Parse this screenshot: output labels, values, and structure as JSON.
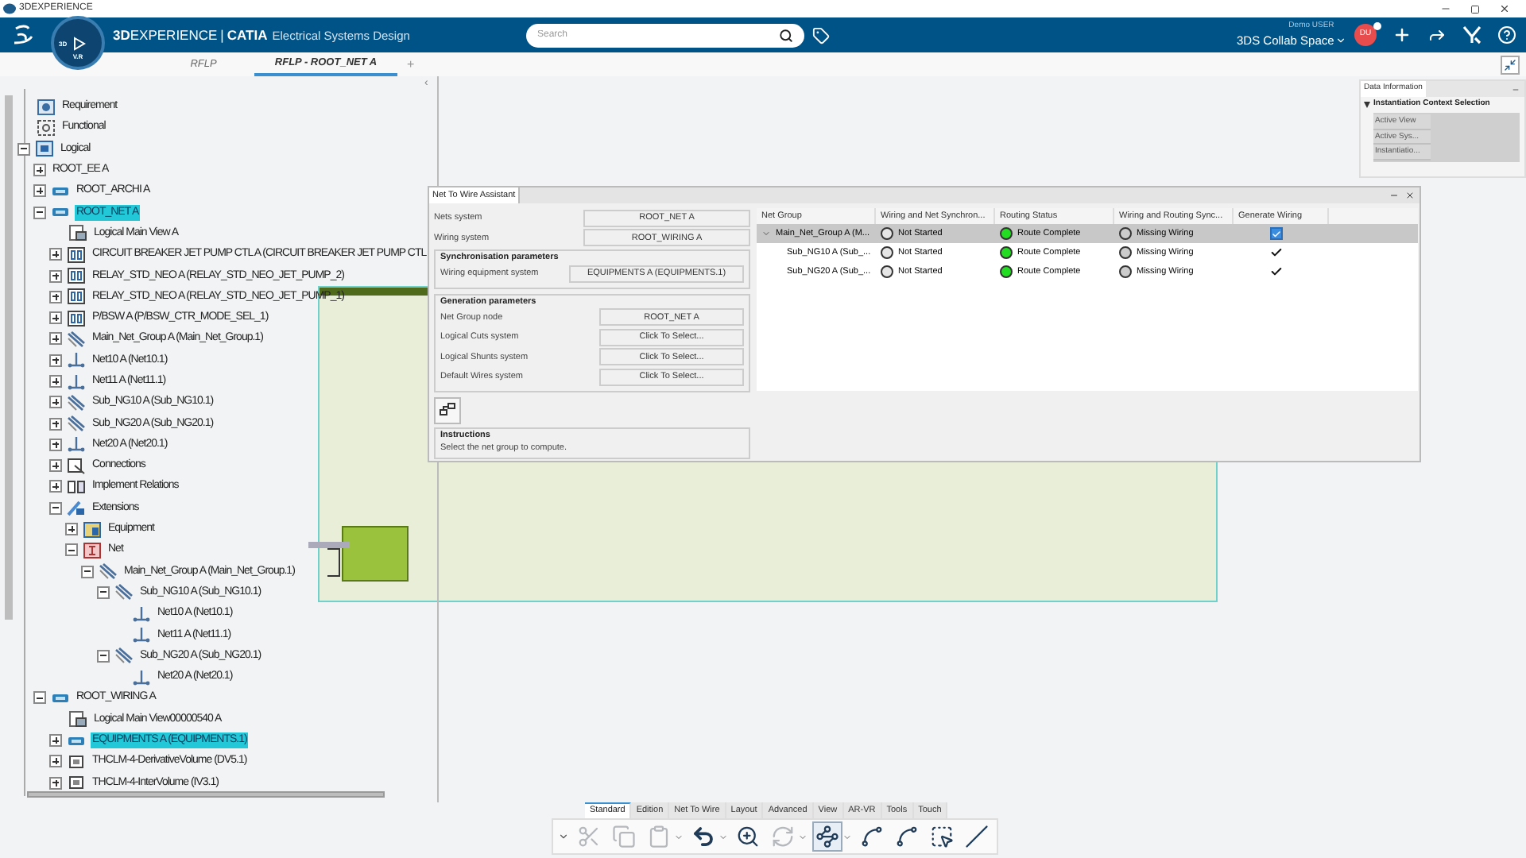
{
  "window": {
    "title": "3DEXPERIENCE"
  },
  "header": {
    "brand_bold": "3D",
    "brand_rest": "EXPERIENCE",
    "separator": "|",
    "product": "CATIA",
    "app": "Electrical Systems Design",
    "compass_left": "3D",
    "compass_bottom": "V.R",
    "search": {
      "placeholder": "Search"
    },
    "user": "Demo USER",
    "space": "3DS Collab Space",
    "avatar": "DU",
    "notification": true
  },
  "tabs": [
    {
      "label": "RFLP",
      "selected": false
    },
    {
      "label": "RFLP - ROOT_NET A",
      "selected": true
    }
  ],
  "add_tab": "+",
  "panel_collapse": "‹",
  "tree": [
    {
      "label": "Requirement",
      "kind": "requirement",
      "selected": false
    },
    {
      "label": "Functional",
      "kind": "functional",
      "selected": false
    },
    {
      "label": "Logical",
      "kind": "logical",
      "selected": false,
      "expanded": true,
      "children": [
        {
          "label": "ROOT_EE A",
          "kind": "none",
          "selected": false,
          "expanded": false
        },
        {
          "label": "ROOT_ARCHI A",
          "kind": "product",
          "selected": false,
          "expanded": false
        },
        {
          "label": "ROOT_NET A",
          "kind": "product",
          "selected": true,
          "expanded": true,
          "children": [
            {
              "label": "Logical Main View A",
              "kind": "view",
              "selected": false
            },
            {
              "label": "CIRCUIT BREAKER JET PUMP CTL A (CIRCUIT BREAKER JET PUMP CTL",
              "kind": "equipment",
              "selected": false,
              "expanded": false
            },
            {
              "label": "RELAY_STD_NEO A (RELAY_STD_NEO_JET_PUMP_2)",
              "kind": "equipment",
              "selected": false,
              "expanded": false
            },
            {
              "label": "RELAY_STD_NEO A (RELAY_STD_NEO_JET_PUMP_1)",
              "kind": "equipment",
              "selected": false,
              "expanded": false
            },
            {
              "label": "P/BSW A (P/BSW_CTR_MODE_SEL_1)",
              "kind": "equipment",
              "selected": false,
              "expanded": false
            },
            {
              "label": "Main_Net_Group A (Main_Net_Group.1)",
              "kind": "netgroup",
              "selected": false,
              "expanded": false
            },
            {
              "label": "Net10 A (Net10.1)",
              "kind": "net",
              "selected": false,
              "expanded": false
            },
            {
              "label": "Net11 A (Net11.1)",
              "kind": "net",
              "selected": false,
              "expanded": false
            },
            {
              "label": "Sub_NG10 A (Sub_NG10.1)",
              "kind": "netgroup",
              "selected": false,
              "expanded": false
            },
            {
              "label": "Sub_NG20 A (Sub_NG20.1)",
              "kind": "netgroup",
              "selected": false,
              "expanded": false
            },
            {
              "label": "Net20 A (Net20.1)",
              "kind": "net",
              "selected": false,
              "expanded": false
            },
            {
              "label": "Connections",
              "kind": "connections",
              "selected": false,
              "expanded": false
            },
            {
              "label": "Implement Relations",
              "kind": "relations",
              "selected": false,
              "expanded": false
            },
            {
              "label": "Extensions",
              "kind": "extensions",
              "selected": false,
              "expanded": true,
              "children": [
                {
                  "label": "Equipment",
                  "kind": "equipment_ext",
                  "selected": false,
                  "expanded": false
                },
                {
                  "label": "Net",
                  "kind": "net_ext",
                  "selected": false,
                  "expanded": true,
                  "children": [
                    {
                      "label": "Main_Net_Group A (Main_Net_Group.1)",
                      "kind": "netgroup",
                      "selected": false,
                      "expanded": true,
                      "children": [
                        {
                          "label": "Sub_NG10 A (Sub_NG10.1)",
                          "kind": "netgroup",
                          "selected": false,
                          "expanded": true,
                          "children": [
                            {
                              "label": "Net10 A (Net10.1)",
                              "kind": "net",
                              "selected": false
                            },
                            {
                              "label": "Net11 A (Net11.1)",
                              "kind": "net",
                              "selected": false
                            }
                          ]
                        },
                        {
                          "label": "Sub_NG20 A (Sub_NG20.1)",
                          "kind": "netgroup",
                          "selected": false,
                          "expanded": true,
                          "children": [
                            {
                              "label": "Net20 A (Net20.1)",
                              "kind": "net",
                              "selected": false
                            }
                          ]
                        }
                      ]
                    }
                  ]
                }
              ]
            }
          ]
        },
        {
          "label": "ROOT_WIRING A",
          "kind": "product",
          "selected": false,
          "expanded": true,
          "children": [
            {
              "label": "Logical Main View00000540 A",
              "kind": "view",
              "selected": false
            },
            {
              "label": "EQUIPMENTS A (EQUIPMENTS.1)",
              "kind": "product",
              "selected": true,
              "expanded": false
            },
            {
              "label": "THCLM-4-DerivativeVolume (DV5.1)",
              "kind": "volume",
              "selected": false,
              "expanded": false
            },
            {
              "label": "THCLM-4-InterVolume (IV3.1)",
              "kind": "volume",
              "selected": false,
              "expanded": false
            }
          ]
        }
      ]
    }
  ],
  "assistant": {
    "title": "Net To Wire Assistant",
    "fields": [
      {
        "label": "Nets system",
        "value": "ROOT_NET A"
      },
      {
        "label": "Wiring system",
        "value": "ROOT_WIRING A"
      }
    ],
    "sync": {
      "title": "Synchronisation parameters",
      "fields": [
        {
          "label": "Wiring equipment system",
          "value": "EQUIPMENTS A (EQUIPMENTS.1)"
        }
      ]
    },
    "generation": {
      "title": "Generation parameters",
      "fields": [
        {
          "label": "Net Group node",
          "value": "ROOT_NET A"
        },
        {
          "label": "Logical Cuts system",
          "value": "Click To Select..."
        },
        {
          "label": "Logical Shunts system",
          "value": "Click To Select..."
        },
        {
          "label": "Default Wires system",
          "value": "Click To Select..."
        }
      ]
    },
    "instructions": {
      "title": "Instructions",
      "text": "Select the net group to compute."
    },
    "columns": [
      "Net Group",
      "Wiring and Net Synchron...",
      "Routing Status",
      "Wiring and Routing Sync...",
      "Generate Wiring"
    ],
    "rows": [
      {
        "net_group": "Main_Net_Group A (M...",
        "selected": true,
        "expanded": true,
        "sync": {
          "text": "Not Started",
          "color": "#e6e6e6"
        },
        "routing": {
          "text": "Route Complete",
          "color": "#22dd22"
        },
        "wiring": {
          "text": "Missing Wiring",
          "color": "#cccccc"
        },
        "generate": {
          "kind": "checkbox",
          "checked": true
        },
        "children": [
          {
            "net_group": "Sub_NG10 A (Sub_...",
            "selected": false,
            "sync": {
              "text": "Not Started",
              "color": "#e6e6e6"
            },
            "routing": {
              "text": "Route Complete",
              "color": "#22dd22"
            },
            "wiring": {
              "text": "Missing Wiring",
              "color": "#cccccc"
            },
            "generate": {
              "kind": "check",
              "checked": true
            }
          },
          {
            "net_group": "Sub_NG20 A (Sub_...",
            "selected": false,
            "sync": {
              "text": "Not Started",
              "color": "#e6e6e6"
            },
            "routing": {
              "text": "Route Complete",
              "color": "#22dd22"
            },
            "wiring": {
              "text": "Missing Wiring",
              "color": "#cccccc"
            },
            "generate": {
              "kind": "check",
              "checked": true
            }
          }
        ]
      }
    ]
  },
  "data_panel": {
    "title": "Data Information",
    "section": {
      "title": "Instantiation Context Selection",
      "expanded": true,
      "rows": [
        "Active View",
        "Active Sys...",
        "Instantiatio..."
      ]
    }
  },
  "toolbar": {
    "tabs": [
      {
        "label": "Standard",
        "selected": true
      },
      {
        "label": "Edition",
        "selected": false
      },
      {
        "label": "Net To Wire",
        "selected": false
      },
      {
        "label": "Layout",
        "selected": false
      },
      {
        "label": "Advanced",
        "selected": false
      },
      {
        "label": "View",
        "selected": false
      },
      {
        "label": "AR-VR",
        "selected": false
      },
      {
        "label": "Tools",
        "selected": false
      },
      {
        "label": "Touch",
        "selected": false
      }
    ],
    "tools": [
      {
        "kind": "cut",
        "disabled": true,
        "menu": false,
        "selected": false
      },
      {
        "kind": "copy",
        "disabled": true,
        "menu": false,
        "selected": false
      },
      {
        "kind": "paste",
        "disabled": true,
        "menu": true,
        "selected": false
      },
      {
        "kind": "undo",
        "disabled": false,
        "menu": true,
        "selected": false
      },
      {
        "kind": "zoom",
        "disabled": false,
        "menu": false,
        "selected": false
      },
      {
        "kind": "refresh",
        "disabled": true,
        "menu": true,
        "selected": false
      },
      {
        "kind": "diagram",
        "disabled": false,
        "menu": true,
        "selected": true
      },
      {
        "kind": "connector",
        "disabled": false,
        "menu": false,
        "selected": false
      },
      {
        "kind": "route",
        "disabled": false,
        "menu": false,
        "selected": false
      },
      {
        "kind": "select",
        "disabled": false,
        "menu": false,
        "selected": false
      },
      {
        "kind": "split",
        "disabled": false,
        "menu": false,
        "selected": false
      }
    ]
  }
}
